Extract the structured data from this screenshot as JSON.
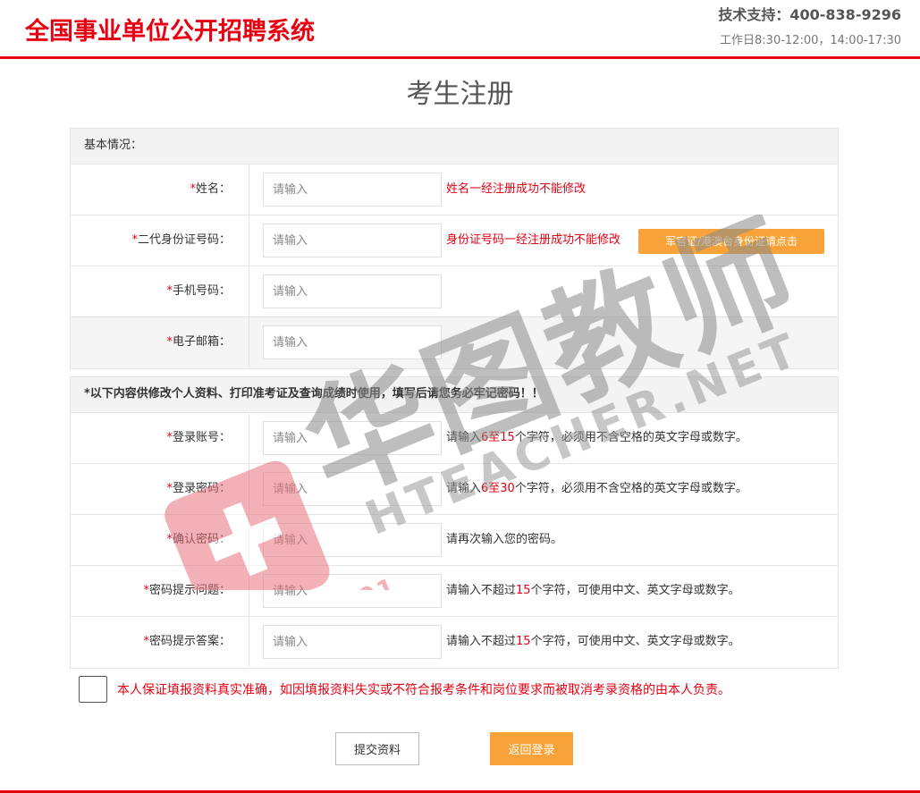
{
  "header": {
    "site_title": "全国事业单位公开招聘系统",
    "support": "技术支持：400-838-9296",
    "hours": "工作日8:30-12:00，14:00-17:30"
  },
  "page_title": "考生注册",
  "section_basic": {
    "title": "基本情况：",
    "fields": [
      {
        "label": "姓名：",
        "placeholder": "请输入",
        "hint": "姓名一经注册成功不能修改"
      },
      {
        "label": "二代身份证号码：",
        "placeholder": "请输入",
        "hint": "身份证号码一经注册成功不能修改",
        "button": "军官证/港澳台身份证请点击"
      },
      {
        "label": "手机号码：",
        "placeholder": "请输入"
      },
      {
        "label": "电子邮箱：",
        "placeholder": "请输入"
      }
    ]
  },
  "section_account": {
    "title": "*以下内容供修改个人资料、打印准考证及查询成绩时使用，填写后请您务必牢记密码！！",
    "fields": [
      {
        "label": "登录账号：",
        "placeholder": "请输入",
        "hint_pre": "请输入",
        "hint_num": "6至15",
        "hint_post": "个字符，必须用不含空格的英文字母或数字。"
      },
      {
        "label": "登录密码：",
        "placeholder": "请输入",
        "hint_pre": "请输入",
        "hint_num": "6至30",
        "hint_post": "个字符，必须用不含空格的英文字母或数字。"
      },
      {
        "label": "确认密码：",
        "placeholder": "请输入",
        "hint": "请再次输入您的密码。"
      },
      {
        "label": "密码提示问题：",
        "placeholder": "请输入",
        "hint_pre": "请输入不超过",
        "hint_num": "15",
        "hint_post": "个字符，可使用中文、英文字母或数字。"
      },
      {
        "label": "密码提示答案：",
        "placeholder": "请输入",
        "hint_pre": "请输入不超过",
        "hint_num": "15",
        "hint_post": "个字符，可使用中文、英文字母或数字。"
      }
    ]
  },
  "required_mark": "*",
  "agreement": "本人保证填报资料真实准确，如因填报资料失实或不符合报考条件和岗位要求而被取消考录资格的由本人负责。",
  "buttons": {
    "submit": "提交资料",
    "back": "返回登录"
  },
  "watermark": {
    "cn": "华图教师",
    "en": "HTEACHER.NET",
    "since": "SINCE 2001"
  },
  "colors": {
    "brand_red": "#e60012",
    "orange": "#f7a339"
  }
}
